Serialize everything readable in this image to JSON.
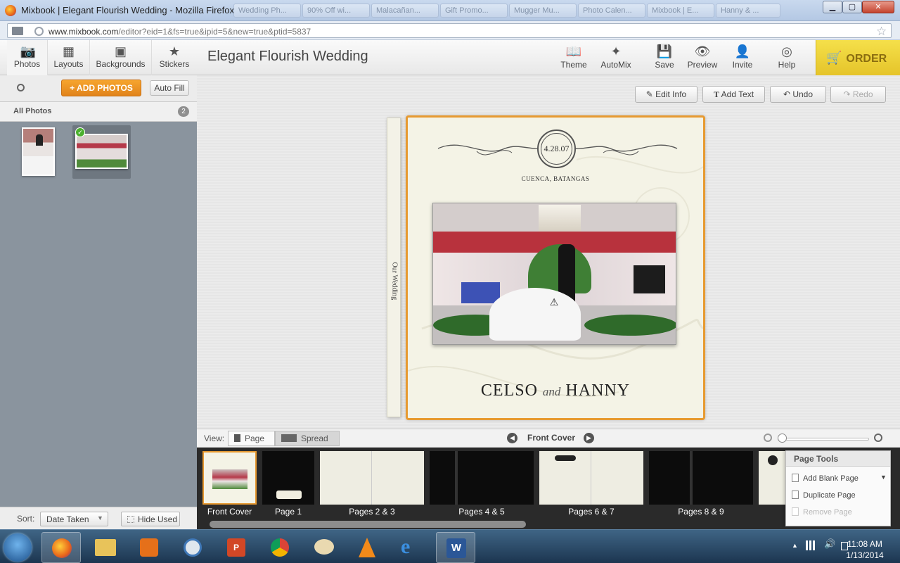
{
  "window": {
    "title": "Mixbook | Elegant Flourish Wedding - Mozilla Firefox",
    "bg_tabs": [
      "Wedding Ph...",
      "90% Off wi...",
      "Malacañan...",
      "Gift Promo...",
      "Mugger Mu...",
      "Photo Calen...",
      "Mixbook | E...",
      "Hanny & ..."
    ],
    "controls": {
      "minimize": "▁",
      "maximize": "▢",
      "close": "✕"
    }
  },
  "browser": {
    "url_host": "www.mixbook.com",
    "url_path": "/editor?eid=1&fs=true&ipid=5&new=true&ptid=5837"
  },
  "left_tabs": [
    {
      "label": "Photos",
      "icon": "camera-icon",
      "glyph": "📷"
    },
    {
      "label": "Layouts",
      "icon": "layouts-icon",
      "glyph": "▦"
    },
    {
      "label": "Backgrounds",
      "icon": "backgrounds-icon",
      "glyph": "▣"
    },
    {
      "label": "Stickers",
      "icon": "star-icon",
      "glyph": "★"
    }
  ],
  "book_title": "Elegant Flourish Wedding",
  "top_tools": [
    {
      "label": "Theme",
      "icon": "book-icon",
      "glyph": "📖"
    },
    {
      "label": "AutoMix",
      "icon": "magic-wand-icon",
      "glyph": "✦"
    },
    {
      "label": "Save",
      "icon": "save-icon",
      "glyph": "💾"
    },
    {
      "label": "Preview",
      "icon": "eye-icon",
      "glyph": "👁"
    },
    {
      "label": "Invite",
      "icon": "add-user-icon",
      "glyph": "👤"
    },
    {
      "label": "Help",
      "icon": "lifebuoy-icon",
      "glyph": "◎"
    }
  ],
  "order_label": "ORDER",
  "photos_panel": {
    "add_photos_label": "ADD PHOTOS",
    "auto_fill_label": "Auto Fill",
    "all_photos_label": "All Photos",
    "photo_count": "2",
    "sort_label": "Sort:",
    "sort_value": "Date Taken",
    "hide_used_label": "Hide Used"
  },
  "edit_buttons": {
    "edit_info": "Edit Info",
    "add_text": "Add Text",
    "undo": "Undo",
    "redo": "Redo"
  },
  "cover": {
    "spine_text": "Our Wedding",
    "date": "4.28.07",
    "location": "CUENCA, BATANGAS",
    "name1": "CELSO",
    "and_word": "and",
    "name2": "HANNY"
  },
  "view_bar": {
    "view_label": "View:",
    "page_tab": "Page",
    "spread_tab": "Spread",
    "current_page": "Front Cover"
  },
  "filmstrip": [
    "Front Cover",
    "Page 1",
    "Pages 2 & 3",
    "Pages 4 & 5",
    "Pages 6 & 7",
    "Pages 8 & 9"
  ],
  "page_tools": {
    "title": "Page Tools",
    "add_blank": "Add Blank Page",
    "duplicate": "Duplicate Page",
    "remove": "Remove Page"
  },
  "clock": {
    "time": "11:08 AM",
    "date": "1/13/2014"
  },
  "colors": {
    "accent_orange": "#e79a31",
    "order_yellow": "#f0d640",
    "add_photos_orange": "#f0961f"
  }
}
